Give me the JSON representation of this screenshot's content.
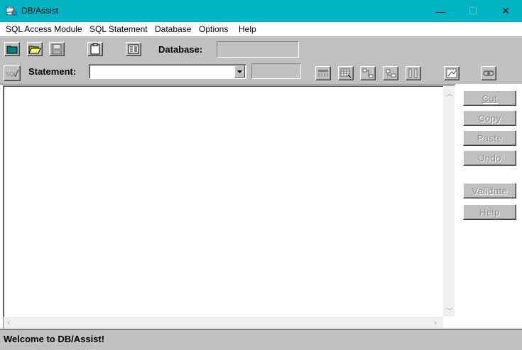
{
  "window": {
    "title": "DB/Assist",
    "controls": {
      "minimize": "—",
      "maximize": "☐",
      "close": "✕"
    }
  },
  "menu": [
    "SQL Access Module",
    "SQL Statement",
    "Database",
    "Options",
    "Help"
  ],
  "toolbar1": {
    "buttons": [
      "new-folder-icon",
      "open-folder-icon",
      "save-disk-icon",
      "clipboard-icon",
      "form-icon"
    ],
    "database_label": "Database:",
    "database_value": ""
  },
  "toolbar2": {
    "sql_icon_text": "SQL",
    "statement_label": "Statement:",
    "statement_value": "",
    "statement_extra": "",
    "buttons": [
      "table-icon",
      "grid-icon",
      "join-icon",
      "relation-icon",
      "columns-icon",
      "run-icon",
      "link-icon"
    ]
  },
  "side_buttons": [
    "Cut",
    "Copy",
    "Paste",
    "Undo",
    "Validate",
    "Help"
  ],
  "editor": {
    "content": ""
  },
  "status": {
    "text": "Welcome to DB/Assist!"
  },
  "colors": {
    "titlebar": "#00b4c4",
    "face": "#c0c0c0",
    "disabled_text": "#8a8a8a"
  }
}
